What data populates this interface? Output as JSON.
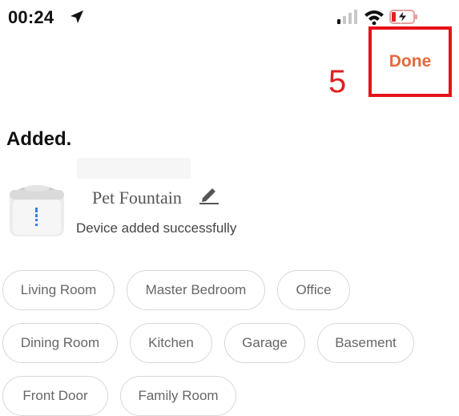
{
  "status_bar": {
    "time": "00:24"
  },
  "annotation": {
    "step": "5"
  },
  "header": {
    "done_label": "Done"
  },
  "main": {
    "title": "Added.",
    "device": {
      "name": "Pet Fountain",
      "status": "Device added successfully"
    },
    "rooms": [
      {
        "label": "Living Room"
      },
      {
        "label": "Master Bedroom"
      },
      {
        "label": "Office"
      },
      {
        "label": "Dining Room"
      },
      {
        "label": "Kitchen"
      },
      {
        "label": "Garage"
      },
      {
        "label": "Basement"
      },
      {
        "label": "Front Door"
      },
      {
        "label": "Family Room"
      }
    ]
  },
  "colors": {
    "accent": "#e5693b",
    "highlight": "#e6121a"
  }
}
